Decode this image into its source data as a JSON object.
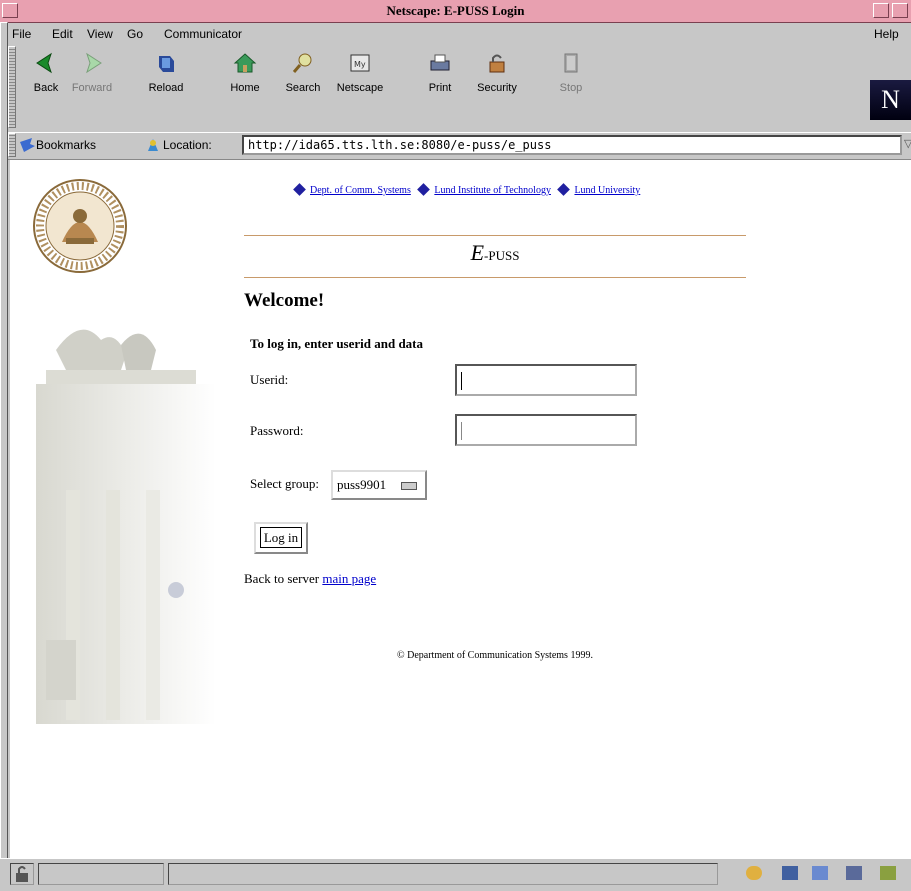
{
  "window": {
    "title": "Netscape: E-PUSS Login"
  },
  "menu": {
    "file": "File",
    "edit": "Edit",
    "view": "View",
    "go": "Go",
    "communicator": "Communicator",
    "help": "Help"
  },
  "toolbar": {
    "back": "Back",
    "forward": "Forward",
    "reload": "Reload",
    "home": "Home",
    "search": "Search",
    "netscape": "Netscape",
    "print": "Print",
    "security": "Security",
    "stop": "Stop"
  },
  "location": {
    "bookmarks": "Bookmarks",
    "label": "Location:",
    "url": "http://ida65.tts.lth.se:8080/e-puss/e_puss"
  },
  "page": {
    "links": [
      "Dept. of Comm. Systems",
      "Lund Institute of Technology",
      "Lund University"
    ],
    "app_title_big": "E",
    "app_title_small": "-PUSS",
    "welcome": "Welcome!",
    "instructions": "To log in, enter userid and data",
    "userid_label": "Userid:",
    "password_label": "Password:",
    "group_label": "Select group:",
    "group_selected": "puss9901",
    "login_label": "Log in",
    "back_text": "Back to server ",
    "back_link": "main page",
    "copyright": "© Department of Communication Systems 1999."
  },
  "colors": {
    "titlebar": "#e8a0b0",
    "link": "#0000cc",
    "rule": "#c89a6a"
  }
}
